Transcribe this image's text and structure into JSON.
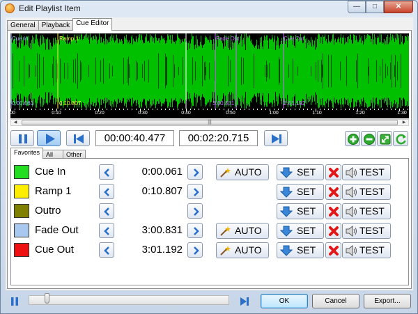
{
  "window": {
    "title": "Edit Playlist Item",
    "minimize": "—",
    "maximize": "□",
    "close": "✕"
  },
  "tabs": [
    {
      "label": "General",
      "active": false
    },
    {
      "label": "Playback",
      "active": false
    },
    {
      "label": "Cue Editor",
      "active": true
    }
  ],
  "waveform": {
    "wave_color": "#00c000",
    "marker_labels": {
      "cue_in": "Cue In",
      "ramp_1": "Ramp 1",
      "ramp_1_time": "0:10.807",
      "cue_in_time": "0:00.061",
      "fade_out": "Fade Out",
      "fade_out_time": "3:00.831",
      "cue_out": "Cue Out",
      "cue_out_time": "3:01.192"
    },
    "timeline_ticks": [
      "00",
      "0:10",
      "0:20",
      "0:30",
      "0:40",
      "0:50",
      "1:00",
      "1:10",
      "1:20",
      "1:30",
      "1:40"
    ]
  },
  "transport": {
    "position": "00:00:40.477",
    "duration": "00:02:20.715",
    "icons": [
      "pause-icon",
      "play-icon",
      "skip-start-icon",
      "skip-end-icon",
      "add-icon",
      "remove-icon",
      "expand-icon",
      "refresh-icon"
    ]
  },
  "inner_tabs": [
    {
      "label": "Favorites",
      "active": true
    },
    {
      "label": "All",
      "active": false
    },
    {
      "label": "Other",
      "active": false
    }
  ],
  "cues": [
    {
      "name": "Cue In",
      "color": "#22dd22",
      "time": "0:00.061",
      "auto": "AUTO",
      "set": "SET",
      "test": "TEST"
    },
    {
      "name": "Ramp 1",
      "color": "#ffee00",
      "time": "0:10.807",
      "auto": null,
      "set": "SET",
      "test": "TEST"
    },
    {
      "name": "Outro",
      "color": "#808000",
      "time": "",
      "auto": null,
      "set": "SET",
      "test": "TEST"
    },
    {
      "name": "Fade Out",
      "color": "#a8c8f0",
      "time": "3:00.831",
      "auto": "AUTO",
      "set": "SET",
      "test": "TEST"
    },
    {
      "name": "Cue Out",
      "color": "#ee1111",
      "time": "3:01.192",
      "auto": "AUTO",
      "set": "SET",
      "test": "TEST"
    }
  ],
  "footer": {
    "ok": "OK",
    "cancel": "Cancel",
    "export": "Export...",
    "scrub_level": 0.08
  }
}
